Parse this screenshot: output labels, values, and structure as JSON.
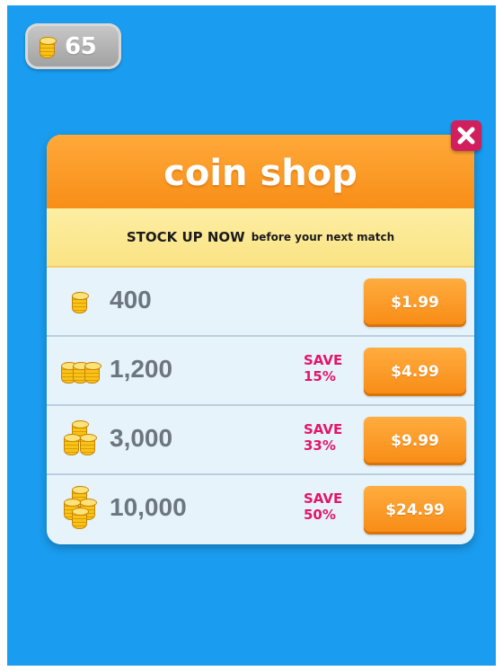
{
  "hud": {
    "coin_count": "65",
    "coin_icon": "coin-stack-icon"
  },
  "shop": {
    "title": "coin shop",
    "subtitle_strong": "STOCK UP NOW",
    "subtitle_rest": "before your next match",
    "close_icon": "close-icon",
    "offers": [
      {
        "amount": "400",
        "save": "",
        "price": "$1.99",
        "icon": "single-coin-stack-icon"
      },
      {
        "amount": "1,200",
        "save": "SAVE 15%",
        "price": "$4.99",
        "icon": "double-coin-stack-icon"
      },
      {
        "amount": "3,000",
        "save": "SAVE 33%",
        "price": "$9.99",
        "icon": "coin-pile-icon"
      },
      {
        "amount": "10,000",
        "save": "SAVE 50%",
        "price": "$24.99",
        "icon": "large-coin-pile-icon"
      }
    ]
  },
  "colors": {
    "background": "#1a9df0",
    "header_orange": "#f88e17",
    "banner_yellow": "#fae385",
    "save_pink": "#e3156b",
    "close_red": "#d11f5e"
  }
}
